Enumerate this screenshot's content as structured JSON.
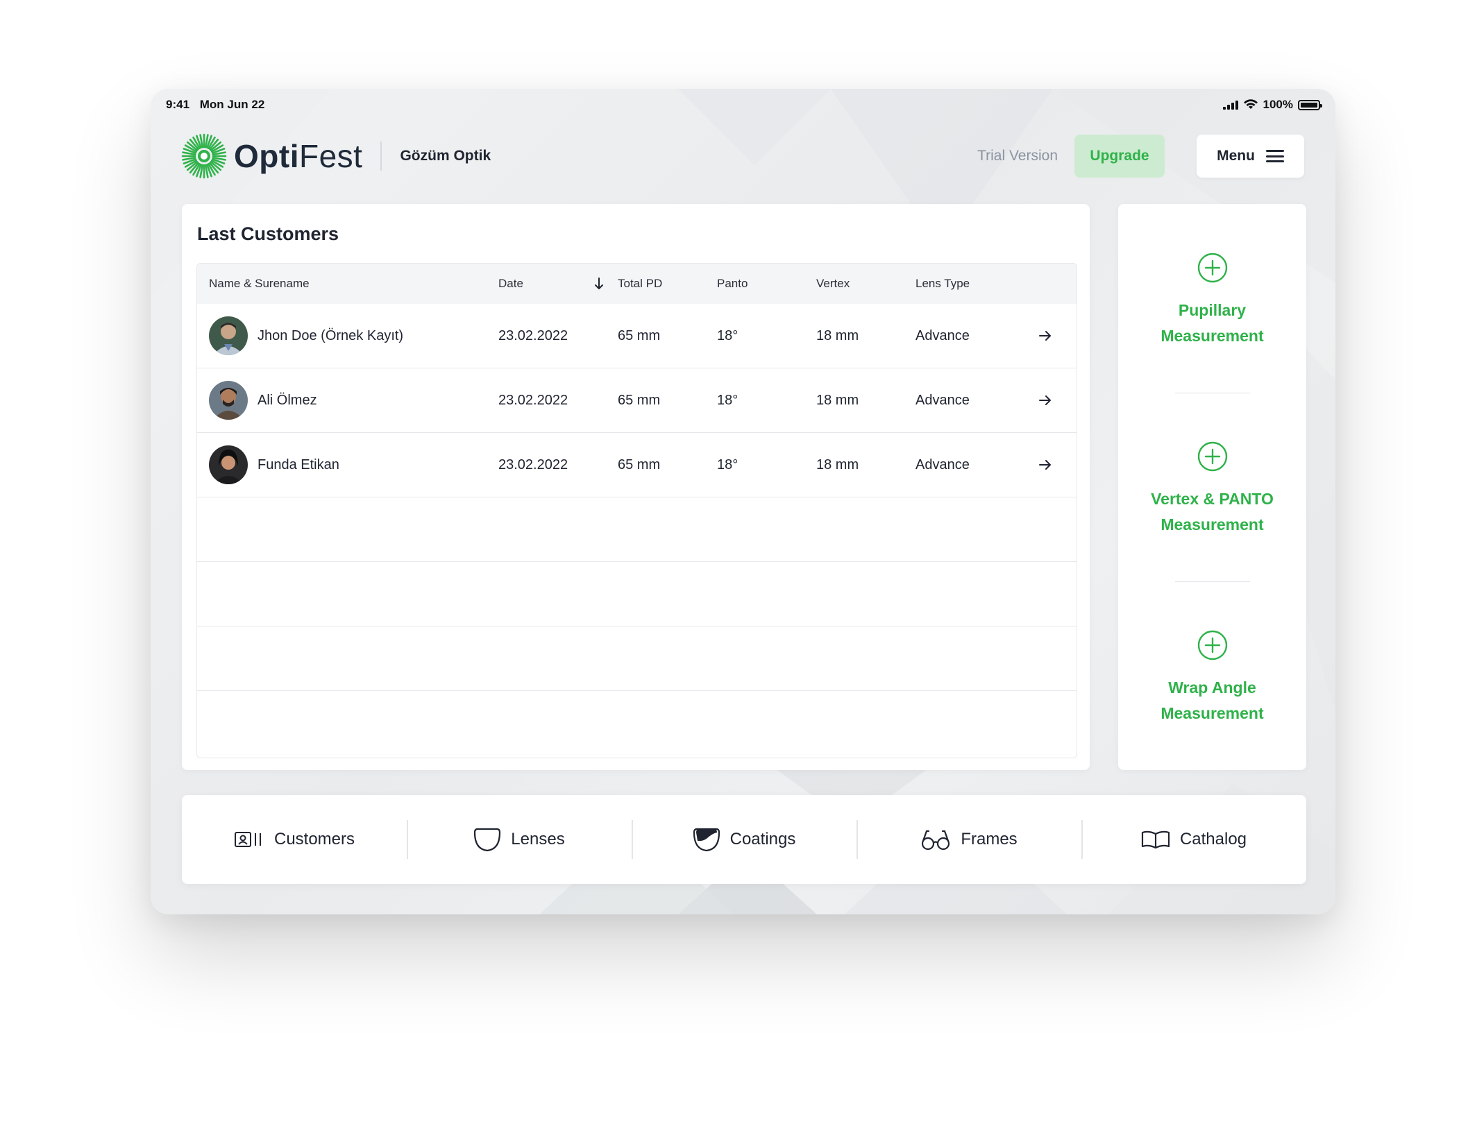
{
  "status_bar": {
    "time": "9:41",
    "date": "Mon Jun 22",
    "battery": "100%"
  },
  "header": {
    "logo_bold": "Opti",
    "logo_light": "Fest",
    "store_name": "Gözüm Optik",
    "trial_label": "Trial Version",
    "upgrade_label": "Upgrade",
    "menu_label": "Menu"
  },
  "customers": {
    "title": "Last Customers",
    "columns": {
      "name": "Name & Surename",
      "date": "Date",
      "pd": "Total PD",
      "panto": "Panto",
      "vertex": "Vertex",
      "lens": "Lens Type"
    },
    "rows": [
      {
        "name": "Jhon Doe (Örnek Kayıt)",
        "date": "23.02.2022",
        "pd": "65 mm",
        "panto": "18°",
        "vertex": "18 mm",
        "lens": "Advance"
      },
      {
        "name": "Ali Ölmez",
        "date": "23.02.2022",
        "pd": "65 mm",
        "panto": "18°",
        "vertex": "18 mm",
        "lens": "Advance"
      },
      {
        "name": "Funda Etikan",
        "date": "23.02.2022",
        "pd": "65 mm",
        "panto": "18°",
        "vertex": "18 mm",
        "lens": "Advance"
      }
    ]
  },
  "measurements": [
    {
      "line1": "Pupillary",
      "line2": "Measurement"
    },
    {
      "line1": "Vertex & PANTO",
      "line2": "Measurement"
    },
    {
      "line1": "Wrap Angle",
      "line2": "Measurement"
    }
  ],
  "bottom_nav": [
    {
      "label": "Customers",
      "icon": "customers-icon"
    },
    {
      "label": "Lenses",
      "icon": "lens-icon"
    },
    {
      "label": "Coatings",
      "icon": "coating-icon"
    },
    {
      "label": "Frames",
      "icon": "glasses-icon"
    },
    {
      "label": "Cathalog",
      "icon": "book-icon"
    }
  ],
  "colors": {
    "accent": "#2fb24a",
    "accent_soft": "#cdebd1",
    "text": "#1f2430",
    "muted": "#8a93a0"
  }
}
